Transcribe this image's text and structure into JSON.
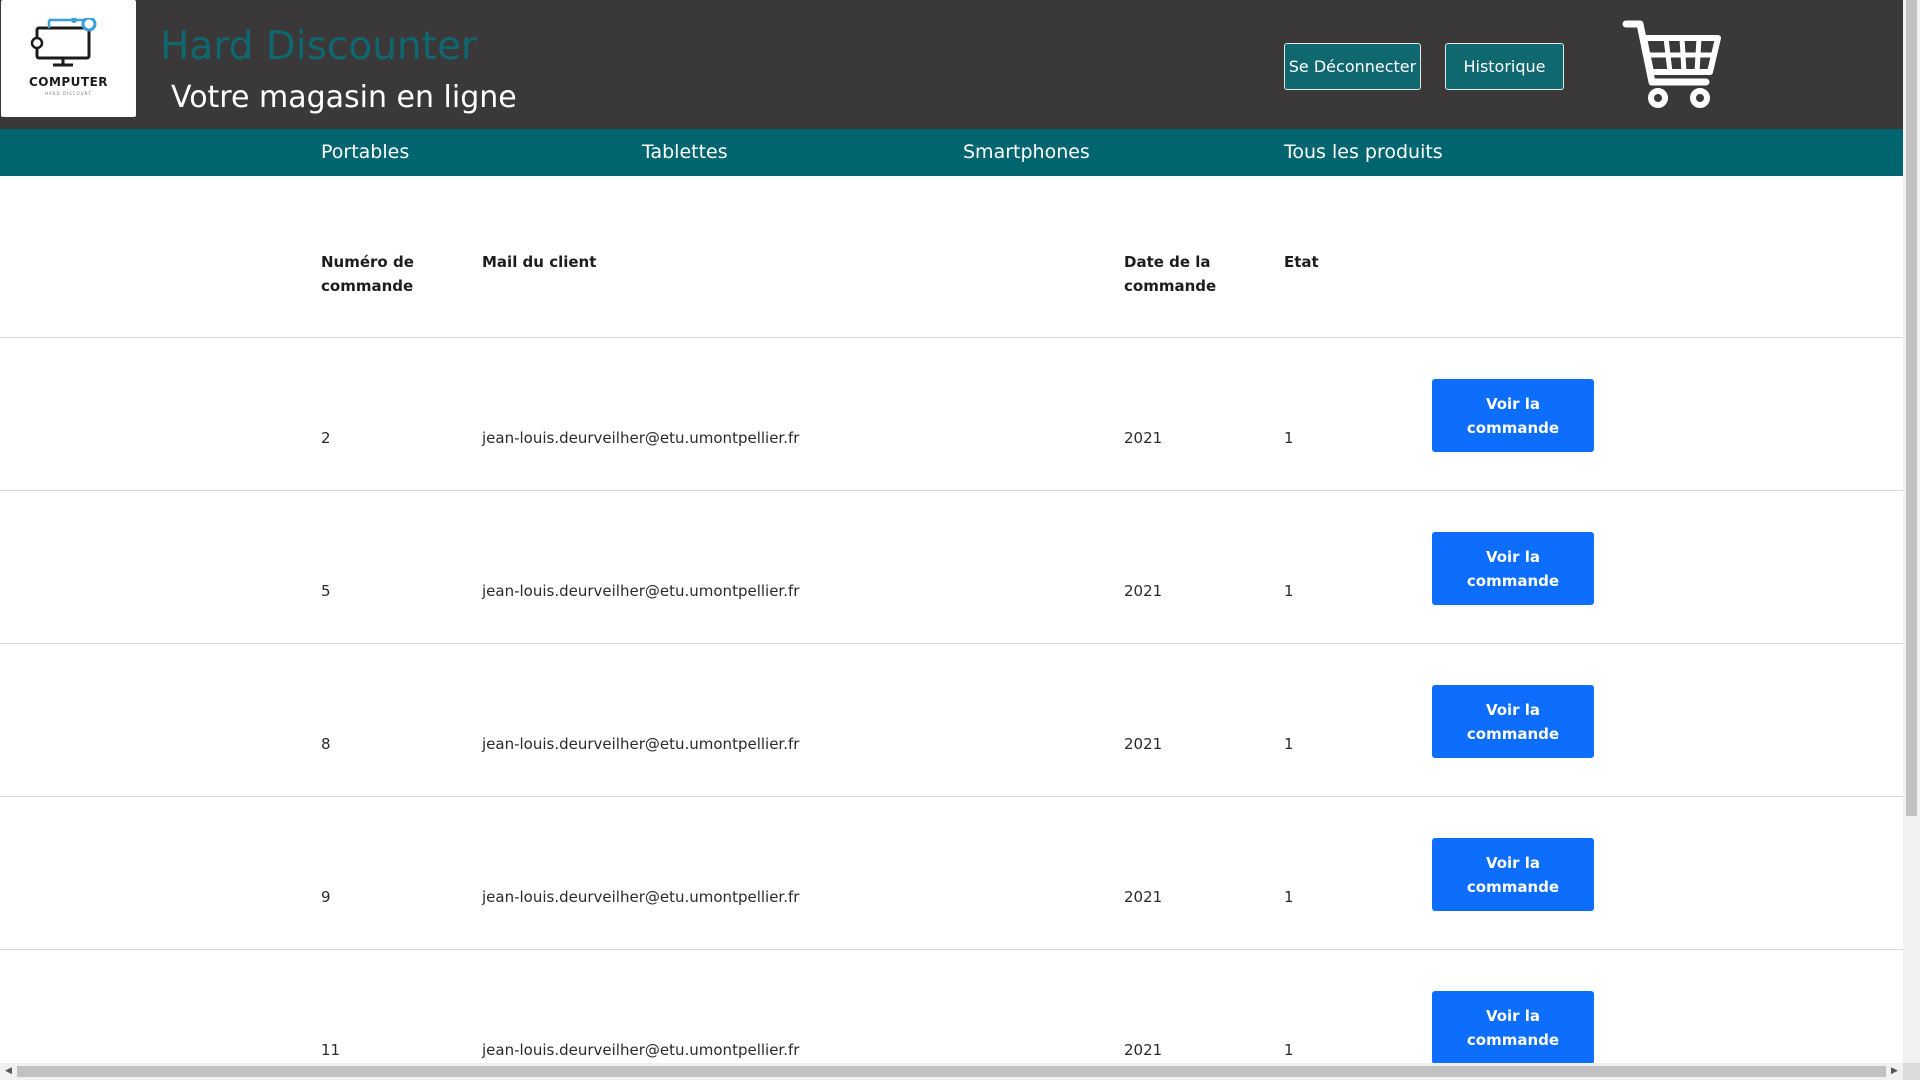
{
  "header": {
    "logo_text": "COMPUTER",
    "logo_tagline": "HARD DISCOUNT",
    "title": "Hard Discounter",
    "subtitle": "Votre magasin en ligne",
    "logout_label": "Se Déconnecter",
    "history_label": "Historique",
    "cart_icon": "shopping-cart-icon"
  },
  "nav": {
    "items": [
      {
        "label": "Portables"
      },
      {
        "label": "Tablettes"
      },
      {
        "label": "Smartphones"
      },
      {
        "label": "Tous les produits"
      }
    ]
  },
  "table": {
    "columns": {
      "num": "Numéro de commande",
      "mail": "Mail du client",
      "date": "Date de la commande",
      "etat": "Etat"
    },
    "rows": [
      {
        "num": "2",
        "mail": "jean-louis.deurveilher@etu.umontpellier.fr",
        "date": "2021",
        "etat": "1",
        "action": "Voir la commande"
      },
      {
        "num": "5",
        "mail": "jean-louis.deurveilher@etu.umontpellier.fr",
        "date": "2021",
        "etat": "1",
        "action": "Voir la commande"
      },
      {
        "num": "8",
        "mail": "jean-louis.deurveilher@etu.umontpellier.fr",
        "date": "2021",
        "etat": "1",
        "action": "Voir la commande"
      },
      {
        "num": "9",
        "mail": "jean-louis.deurveilher@etu.umontpellier.fr",
        "date": "2021",
        "etat": "1",
        "action": "Voir la commande"
      },
      {
        "num": "11",
        "mail": "jean-louis.deurveilher@etu.umontpellier.fr",
        "date": "2021",
        "etat": "1",
        "action": "Voir la commande"
      }
    ]
  },
  "colors": {
    "header_bg": "#3a3838",
    "brand_teal": "#0f6770",
    "nav_bg": "#00656e",
    "primary_button": "#0d6efd"
  }
}
